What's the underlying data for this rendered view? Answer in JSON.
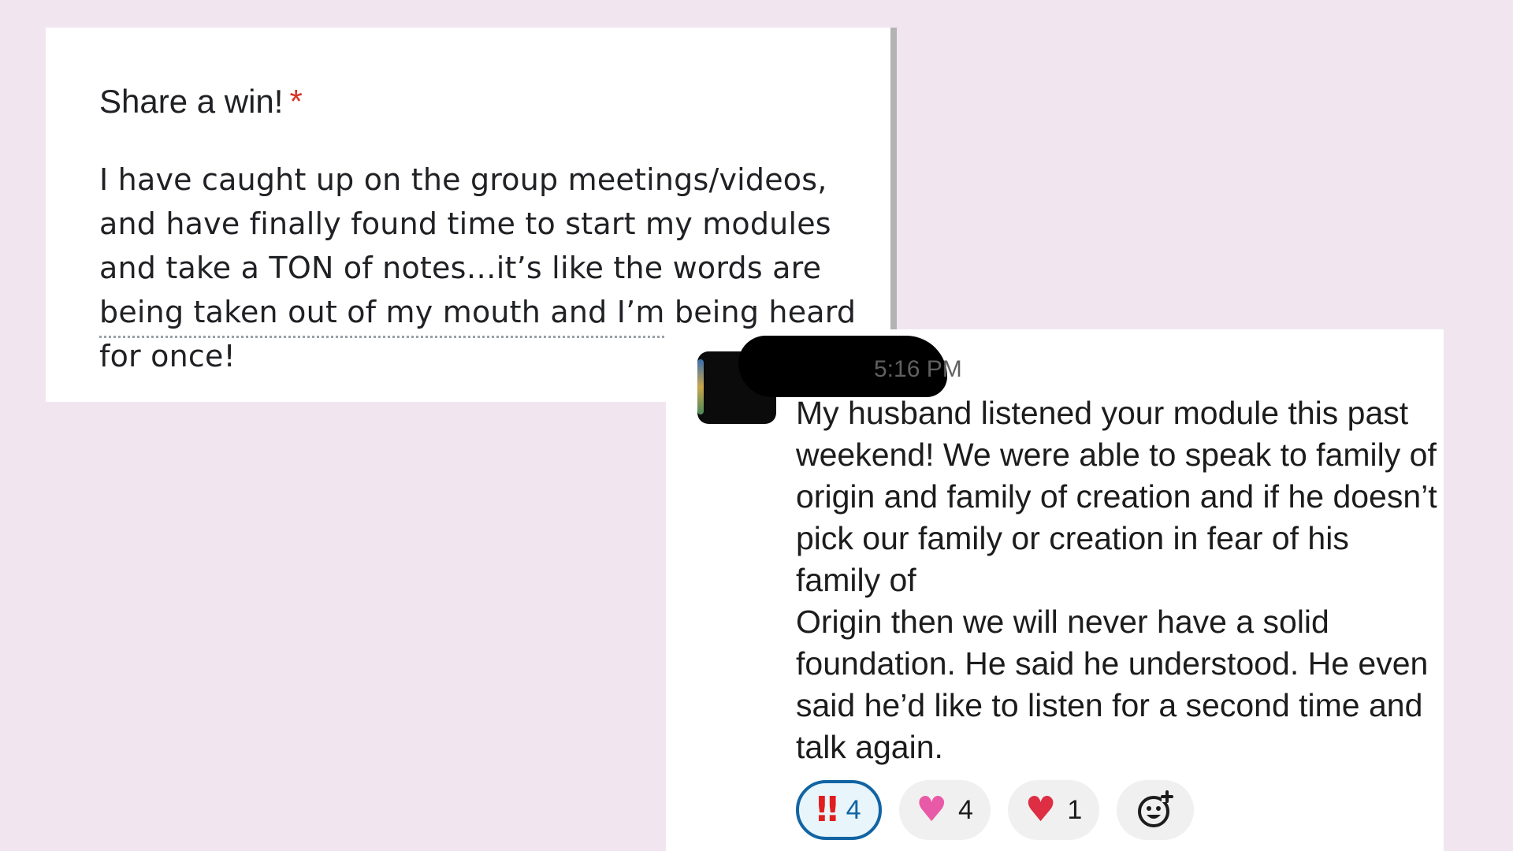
{
  "form": {
    "question": "Share a win!",
    "required_marker": "*",
    "answer": "I have caught up on the group meetings/videos, and have finally found time to start my modules and take a TON of notes…it’s like the words are being taken out of my mouth and I’m being heard for once!"
  },
  "chat": {
    "timestamp": "5:16 PM",
    "message": "My husband listened your module this past weekend! We were able to speak to family of origin and family of creation and if he doesn’t pick our family or creation in fear of his family of\nOrigin then we will never have a solid foundation. He said he understood. He even said he’d like to listen for a second time and talk again.",
    "reactions": [
      {
        "icon": "double-exclamation-icon",
        "glyph": "‼",
        "count": "4",
        "active": true
      },
      {
        "icon": "sparkling-heart-icon",
        "glyph": "♥",
        "count": "4",
        "active": false
      },
      {
        "icon": "red-heart-icon",
        "glyph": "♥",
        "count": "1",
        "active": false
      }
    ],
    "add_reaction_icon": "add-reaction-icon"
  },
  "colors": {
    "background": "#f1e6f0",
    "required": "#d93025",
    "reaction_active_border": "#1264a3"
  }
}
